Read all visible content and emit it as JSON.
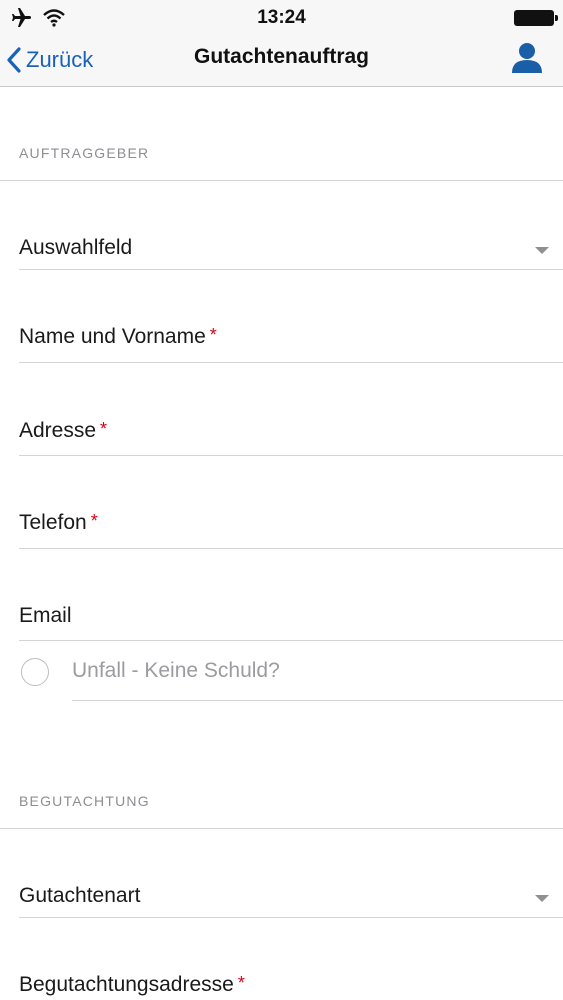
{
  "status_bar": {
    "time": "13:24"
  },
  "nav": {
    "back_label": "Zurück",
    "title": "Gutachtenauftrag"
  },
  "sections": {
    "auftraggeber": "AUFTRAGGEBER",
    "begutachtung": "BEGUTACHTUNG"
  },
  "fields": {
    "auswahlfeld": "Auswahlfeld",
    "name": "Name und Vorname",
    "adresse": "Adresse",
    "telefon": "Telefon",
    "email": "Email",
    "gutachtenart": "Gutachtenart",
    "begutachtungsadresse": "Begutachtungsadresse",
    "required_mark": "*"
  },
  "checkbox": {
    "unfall_label": "Unfall - Keine Schuld?"
  },
  "colors": {
    "accent": "#1a62b8",
    "required": "#d0021b",
    "section_text": "#8e8e93"
  }
}
